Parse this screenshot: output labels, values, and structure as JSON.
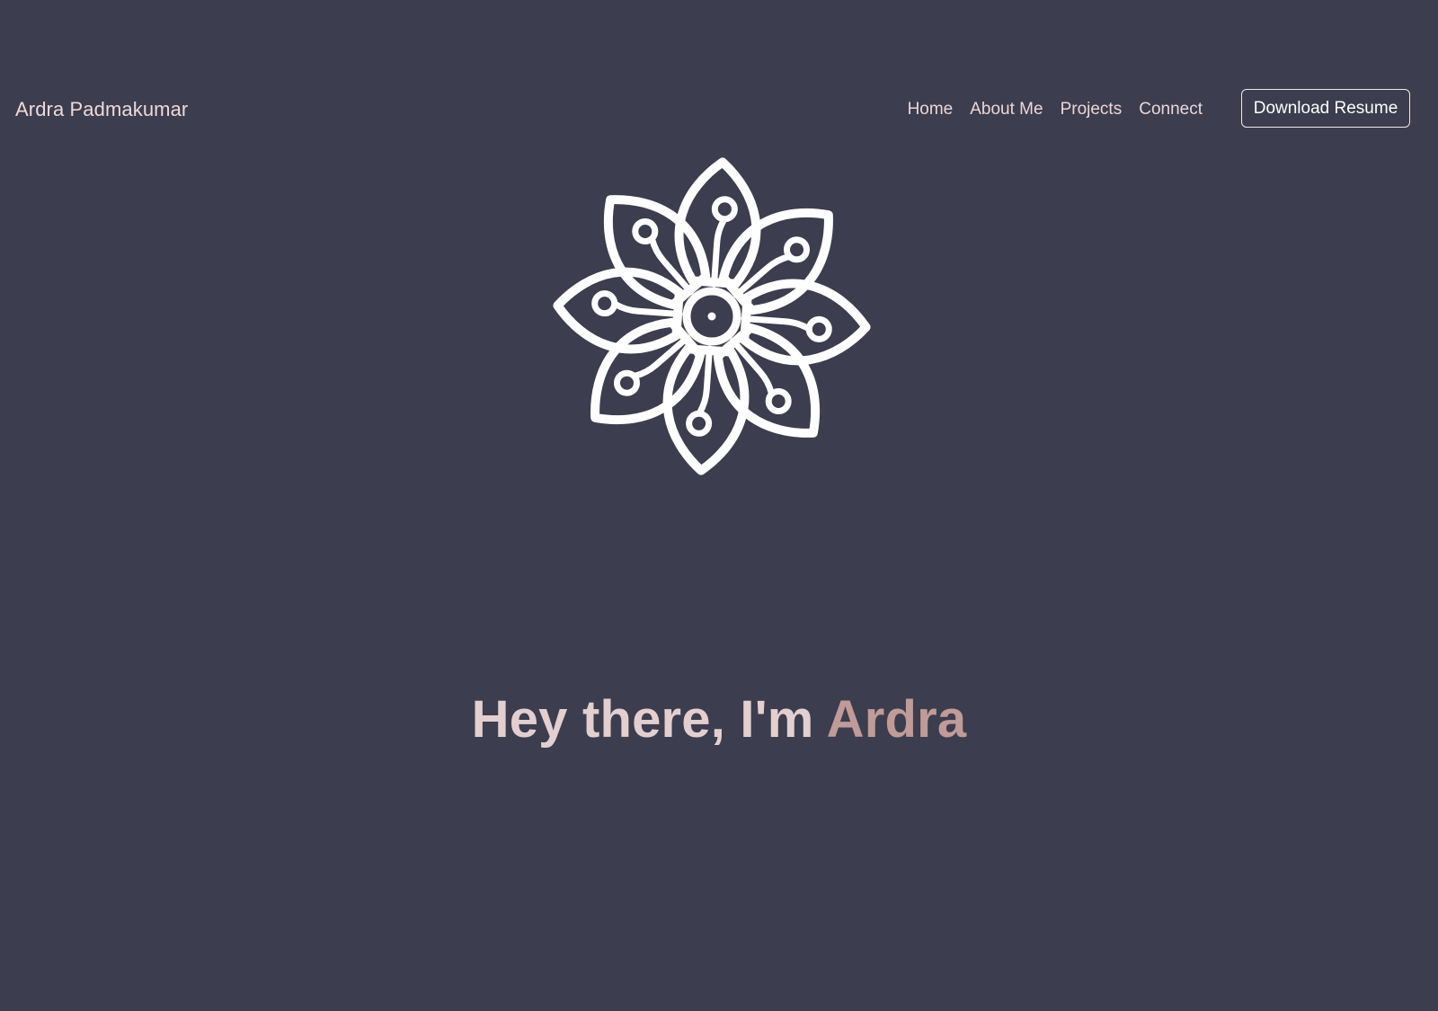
{
  "nav": {
    "brand": "Ardra Padmakumar",
    "links": [
      "Home",
      "About Me",
      "Projects",
      "Connect"
    ],
    "resume_button": "Download Resume"
  },
  "hero": {
    "logo_icon": "flower-circuit-icon",
    "greeting": "Hey there, I'm",
    "name": "Ardra"
  },
  "colors": {
    "background": "#3c3d4e",
    "text": "#e3cfcf",
    "accent": "#c09b97",
    "logo": "#ffffff"
  }
}
